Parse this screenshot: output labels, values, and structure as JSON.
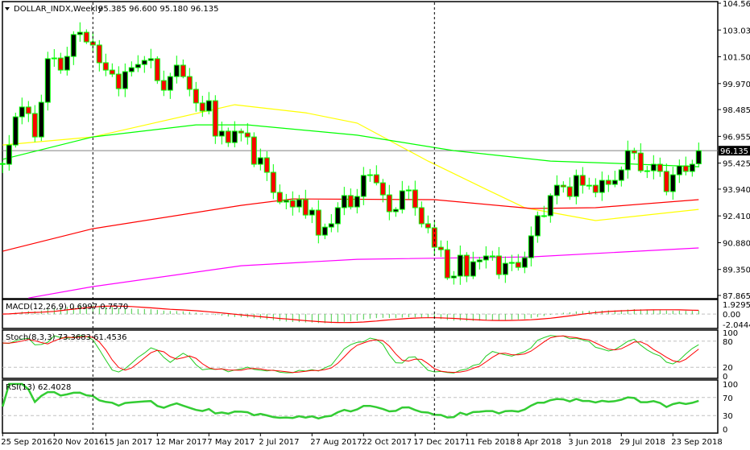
{
  "header": {
    "symbol_timeframe": "DOLLAR_INDX,Weekly",
    "ohlc": "95.385 96.600 95.180 96.135"
  },
  "colors": {
    "background": "#ffffff",
    "bull_fill": "#000000",
    "bear_fill": "#ff0000",
    "candle_outline": "#00ff00",
    "ma_yellow": "#ffff00",
    "ma_green": "#00ff00",
    "ma_red": "#ff0000",
    "ma_magenta": "#ff00ff",
    "price_line": "#808080"
  },
  "price_axis": {
    "max": 104.56,
    "min": 87.865,
    "labels": [
      "104.560",
      "103.030",
      "101.500",
      "99.970",
      "98.485",
      "96.955",
      "95.425",
      "93.940",
      "92.410",
      "90.880",
      "89.350",
      "87.865"
    ],
    "current_price": "96.135"
  },
  "indicators": {
    "macd": {
      "label": "MACD(12,26,9) 0.6997 0.7570",
      "axis": [
        "1.9295",
        "0.00",
        "-2.0444"
      ],
      "max": 1.9295,
      "min": -2.0444
    },
    "stoch": {
      "label": "Stoch(8,3,3) 73.3683 61.4536",
      "axis": [
        "100",
        "80",
        "20",
        "0"
      ]
    },
    "rsi": {
      "label": "RSI(13) 62.4028",
      "axis": [
        "100",
        "70",
        "30",
        "0"
      ]
    }
  },
  "time_axis": {
    "labels": [
      {
        "index": 0,
        "text": "25 Sep 2016"
      },
      {
        "index": 8,
        "text": "20 Nov 2016"
      },
      {
        "index": 16,
        "text": "15 Jan 2017"
      },
      {
        "index": 24,
        "text": "12 Mar 2017"
      },
      {
        "index": 32,
        "text": "7 May 2017"
      },
      {
        "index": 40,
        "text": "2 Jul 2017"
      },
      {
        "index": 48,
        "text": "27 Aug 2017"
      },
      {
        "index": 56,
        "text": "22 Oct 2017"
      },
      {
        "index": 64,
        "text": "17 Dec 2017"
      },
      {
        "index": 72,
        "text": "11 Feb 2018"
      },
      {
        "index": 80,
        "text": "8 Apr 2018"
      },
      {
        "index": 88,
        "text": "3 Jun 2018"
      },
      {
        "index": 96,
        "text": "29 Jul 2018"
      },
      {
        "index": 104,
        "text": "23 Sep 2018"
      }
    ],
    "separators": [
      14,
      67
    ]
  },
  "chart_data": {
    "type": "candlestick",
    "first_open": 95.4,
    "last_bar": {
      "open": 95.385,
      "high": 96.6,
      "low": 95.18,
      "close": 96.135
    },
    "closes": [
      95.36,
      96.46,
      98.07,
      98.63,
      98.26,
      96.92,
      98.9,
      101.39,
      101.43,
      100.74,
      101.52,
      102.77,
      102.9,
      102.35,
      102.17,
      101.16,
      100.74,
      100.51,
      99.68,
      100.65,
      100.88,
      101.06,
      101.29,
      101.39,
      100.14,
      99.59,
      100.37,
      101.02,
      100.37,
      99.64,
      98.86,
      98.4,
      98.99,
      96.97,
      97.25,
      96.6,
      97.25,
      97.15,
      96.92,
      95.36,
      95.73,
      94.9,
      93.75,
      93.2,
      93.29,
      92.92,
      93.34,
      92.46,
      92.74,
      91.31,
      91.77,
      91.96,
      92.88,
      93.57,
      92.92,
      93.52,
      94.72,
      94.76,
      94.3,
      93.61,
      92.65,
      92.78,
      93.84,
      93.89,
      92.88,
      91.96,
      91.73,
      90.62,
      90.48,
      88.87,
      88.97,
      90.16,
      88.97,
      89.79,
      89.89,
      90.12,
      90.12,
      89.06,
      89.7,
      89.75,
      89.47,
      90.02,
      91.27,
      92.42,
      92.42,
      93.57,
      94.16,
      94.07,
      93.52,
      94.72,
      94.16,
      94.16,
      93.75,
      94.44,
      94.21,
      94.44,
      95.04,
      96.14,
      96.0,
      94.99,
      94.99,
      95.36,
      94.95,
      93.8,
      94.76,
      95.27,
      94.95,
      95.36,
      96.135
    ],
    "moving_averages": [
      {
        "name": "ma-yellow",
        "color": "#ffff00",
        "points": [
          [
            0,
            96.46
          ],
          [
            14,
            96.92
          ],
          [
            25,
            97.84
          ],
          [
            36,
            98.76
          ],
          [
            47,
            98.3
          ],
          [
            55,
            97.71
          ],
          [
            66,
            95.54
          ],
          [
            75,
            93.93
          ],
          [
            81,
            92.88
          ],
          [
            92,
            92.14
          ],
          [
            108,
            92.78
          ]
        ]
      },
      {
        "name": "ma-green",
        "color": "#00ff00",
        "points": [
          [
            0,
            95.64
          ],
          [
            14,
            96.92
          ],
          [
            30,
            97.61
          ],
          [
            38,
            97.61
          ],
          [
            55,
            97.02
          ],
          [
            70,
            96.14
          ],
          [
            85,
            95.54
          ],
          [
            95,
            95.41
          ],
          [
            108,
            95.22
          ]
        ]
      },
      {
        "name": "ma-red",
        "color": "#ff0000",
        "points": [
          [
            0,
            90.39
          ],
          [
            14,
            91.68
          ],
          [
            37,
            93.01
          ],
          [
            45,
            93.38
          ],
          [
            67,
            93.34
          ],
          [
            82,
            92.83
          ],
          [
            92,
            92.88
          ],
          [
            108,
            93.34
          ]
        ]
      },
      {
        "name": "ma-magenta",
        "color": "#ff00ff",
        "points": [
          [
            4,
            87.72
          ],
          [
            14,
            88.37
          ],
          [
            37,
            89.56
          ],
          [
            55,
            89.93
          ],
          [
            82,
            90.07
          ],
          [
            108,
            90.58
          ]
        ]
      }
    ]
  }
}
